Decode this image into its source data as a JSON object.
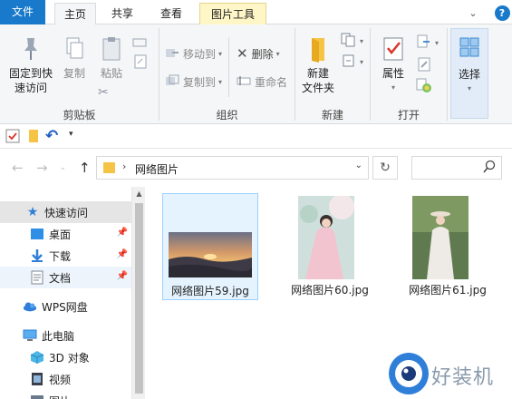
{
  "tabs": {
    "file": "文件",
    "home": "主页",
    "share": "共享",
    "view": "查看",
    "picture_tools": "图片工具"
  },
  "ribbon": {
    "clipboard": {
      "pin_quick_access": "固定到快\n速访问",
      "pin_line1": "固定到快",
      "pin_line2": "速访问",
      "copy": "复制",
      "paste": "粘贴",
      "label": "剪贴板"
    },
    "organize": {
      "move_to": "移动到",
      "copy_to": "复制到",
      "delete": "删除",
      "rename": "重命名",
      "label": "组织"
    },
    "new": {
      "new_folder_line1": "新建",
      "new_folder_line2": "文件夹",
      "label": "新建"
    },
    "open": {
      "properties": "属性",
      "label": "打开"
    },
    "select": {
      "select": "选择"
    }
  },
  "address": {
    "path": "网络图片"
  },
  "nav": {
    "items": [
      {
        "label": "快速访问",
        "icon": "star-icon"
      },
      {
        "label": "桌面",
        "icon": "desktop-icon"
      },
      {
        "label": "下载",
        "icon": "download-icon"
      },
      {
        "label": "文档",
        "icon": "document-icon"
      },
      {
        "label": "WPS网盘",
        "icon": "cloud-icon"
      },
      {
        "label": "此电脑",
        "icon": "computer-icon"
      },
      {
        "label": "3D 对象",
        "icon": "cube-icon"
      },
      {
        "label": "视频",
        "icon": "video-icon"
      },
      {
        "label": "图片",
        "icon": "pictures-icon"
      }
    ]
  },
  "files": [
    {
      "name": "网络图片59.jpg",
      "kind": "landscape"
    },
    {
      "name": "网络图片60.jpg",
      "kind": "portrait"
    },
    {
      "name": "网络图片61.jpg",
      "kind": "portrait"
    }
  ],
  "watermark": {
    "text": "好装机"
  },
  "colors": {
    "accent": "#1979ca",
    "file_tab": "#1979ca",
    "selection_bg": "#e5f3ff",
    "selection_border": "#99d1ff",
    "context_tab": "#fff6c7"
  }
}
